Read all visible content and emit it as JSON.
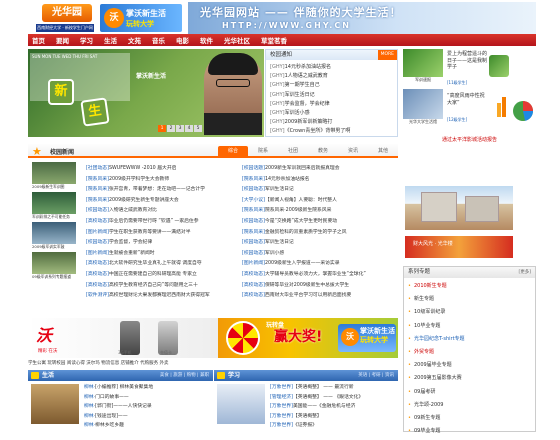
{
  "header": {
    "logo_text": "光华园",
    "logo_sub": "西南财经大学 · 新校学生门户网站",
    "logo_url": "WWW.GHY.CN",
    "wo_line1": "掌沃新生活",
    "wo_line2": "玩转大学",
    "slogan_main": "光华园网站 —— 伴随你的大学生活！",
    "slogan_url": "HTTP://WWW.GHY.CN"
  },
  "nav": [
    "首页",
    "要闻",
    "学习",
    "生活",
    "文苑",
    "音乐",
    "电影",
    "软件",
    "光华社区",
    "草堂茗香"
  ],
  "hero": {
    "days": "SUN MON TUE WED THU FRI SAT",
    "badge": "掌沃新生活",
    "pages": [
      "1",
      "2",
      "3",
      "4",
      "5"
    ],
    "active_page": 1
  },
  "notice": {
    "title": "校园通知",
    "more": "MORE",
    "items": [
      {
        "tag": "[GHY]",
        "text": "14元秒杀加油站报名"
      },
      {
        "tag": "[GHY]",
        "text": "1人物语之威武教育"
      },
      {
        "tag": "[GHY]",
        "text": "第一期学生自己"
      },
      {
        "tag": "[GHY]",
        "text": "军训生活日记"
      },
      {
        "tag": "[GHY]",
        "text": "学会监督，学会纪律"
      },
      {
        "tag": "[GHY]",
        "text": "军训活小感"
      },
      {
        "tag": "[GHY]",
        "text": "2009新军训新策略打"
      },
      {
        "tag": "[GHY]",
        "text": "《Crown青坐所》背带男了啊"
      }
    ]
  },
  "right_profiles": {
    "p1_label": "军训速报",
    "p1_text": "爱上为程营遥斗的日子——这是我制学子",
    "p1_link": "[11级学生]",
    "p3_label": "光华大学生活馆",
    "p3_text": "“高度风雨中性祝大家”",
    "p3_link": "[12级学生]",
    "headline": "通过太平洋影城活动报告"
  },
  "campus": {
    "title": "校园新闻",
    "tabs": [
      "综合",
      "院系",
      "社团",
      "教务",
      "资讯",
      "其他"
    ],
    "active_tab": 0,
    "thumbs": [
      {
        "caption": "2009级新生军训图"
      },
      {
        "caption": "军训彩排之不可能任务"
      },
      {
        "caption": "2009级军训实军鼓"
      },
      {
        "caption": "09级军训系列专题报道"
      }
    ],
    "left_news": [
      {
        "tag": "[社团动态]",
        "text": "SWUFEWWW -2010 届大开启"
      },
      {
        "tag": "[院系风采]",
        "text": "2009级开学科学生大会教师"
      },
      {
        "tag": "[院系风采]",
        "text": "张开宫青，带着梦想：走在动吧——记合计学"
      },
      {
        "tag": "[院系风采]",
        "text": "2009级研究生新生专题讲座大会"
      },
      {
        "tag": "[校园动态]",
        "text": "入物语之威武教育对比"
      },
      {
        "tag": "[高校动态]",
        "text": "毕业后仍需要带世行呀 “钦遇” 一家后住参"
      },
      {
        "tag": "[图片新闻]",
        "text": "学生在职生获教育等要讲——满结对半"
      },
      {
        "tag": "[校园动态]",
        "text": "学会监督，学会纪律"
      },
      {
        "tag": "[图片新闻]",
        "text": "生就被会重新”新闻时"
      },
      {
        "tag": "[高校动态]",
        "text": "北大软件研究生毕业真礼上午就得 调度自夺"
      },
      {
        "tag": "[高校动态]",
        "text": "中国正在需要建自己的科研理高能 专家立"
      },
      {
        "tag": "[高校动态]",
        "text": "高校学生教育经济自己向”等问题用之三十"
      },
      {
        "tag": "[软件测评]",
        "text": "高校世理财论大果发都赛理迟西南财大获得冠军"
      }
    ],
    "right_news": [
      {
        "tag": "[校园话题]",
        "text": "2009新生军训就回来后就报真理会"
      },
      {
        "tag": "[院系风采]",
        "text": "14元秒杀加油站报名"
      },
      {
        "tag": "[校园动态]",
        "text": "军训生活日记"
      },
      {
        "tag": "[大学小议]",
        "text": "【新闻人视角】人要聪：时代整人"
      },
      {
        "tag": "[院系风采]",
        "text": "院系风采·2009级新生院系风采"
      },
      {
        "tag": "[校园动态]",
        "text": "今是“交换路”成大学生更时民要动"
      },
      {
        "tag": "[院系风采]",
        "text": "金融贸检科的双重素质学生的学子之风"
      },
      {
        "tag": "[校园动态]",
        "text": "军训生活日记"
      },
      {
        "tag": "[校园动态]",
        "text": "军训小感"
      },
      {
        "tag": "[图片新闻]",
        "text": "2009级新生入学报道——采访实录"
      },
      {
        "tag": "[高校动态]",
        "text": "大学辅导员教导必须力大，掌握毕业生“全球化”"
      },
      {
        "tag": "[高校动态]",
        "text": "保研等毕业对2009级新生中总拔大学生"
      },
      {
        "tag": "[高校动态]",
        "text": "西南财大毕业平台学习可以用新后面找要"
      },
      {
        "tag": "[软件测评]",
        "text": "超值享“时时”，三成大学毕业生想创业"
      }
    ]
  },
  "sidebar_title": "系列专题",
  "sidebar_date": "2009-09-25",
  "hall_caption": "财大风光 · 光华楼",
  "special": {
    "title": "系列专题",
    "more": "[更多]",
    "items": [
      {
        "text": "2010新生专题",
        "style": "red"
      },
      {
        "text": "新生专题",
        "style": "normal"
      },
      {
        "text": "10级军训纪录",
        "style": "normal"
      },
      {
        "text": "10毕业专题",
        "style": "normal"
      },
      {
        "text": "光华园纪念T-shirt专题",
        "style": "blue"
      },
      {
        "text": "外贸专题",
        "style": "red"
      },
      {
        "text": "2009届毕业专题",
        "style": "normal"
      },
      {
        "text": "2009第五届影像大赛",
        "style": "normal"
      },
      {
        "text": "09届考研",
        "style": "normal"
      },
      {
        "text": "光华颂-2009",
        "style": "normal"
      },
      {
        "text": "09新生专题",
        "style": "normal"
      },
      {
        "text": "09毕业专题",
        "style": "normal"
      }
    ]
  },
  "banner": {
    "wo": "沃",
    "wo_sub": "精彩 在沃",
    "phones": [
      "3G手机",
      "充值卡"
    ],
    "small": "玩转盘",
    "big": "赢大奖!",
    "wo2_l1": "掌沃新生活",
    "wo2_l2": "玩转大学"
  },
  "linkbar": "  学生公寓  玩转校园  阅读心得  沃尔玛  物流信息  店铺推介  代购服务  外卖",
  "life": {
    "title": "生活",
    "right": "美食 | 旅游 | 购物 | 兼职",
    "items": [
      {
        "tag": "柳林·",
        "text": "[小编推荐] 柳林美食聚集地"
      },
      {
        "tag": "柳林·",
        "text": "门口的故事——"
      },
      {
        "tag": "柳林·",
        "text": "[郭门街]——一人快快记录"
      },
      {
        "tag": "柳林·",
        "text": "[钱途出现]——"
      },
      {
        "tag": "柳林·",
        "text": "柳林乡吃乡趣"
      },
      {
        "tag": "柳林·",
        "text": "温家城镇大开肘"
      }
    ]
  },
  "study": {
    "title": "学习",
    "right": "英语 | 考研 | 资讯",
    "items": [
      {
        "tag": "[万象世界]",
        "text": "【英语概整】 —— 最流行新"
      },
      {
        "tag": "[管理经济]",
        "text": "【英语概整】 —— 《跟话文化》"
      },
      {
        "tag": "[万象世界]",
        "text": "美国能——《金融危机与经济"
      },
      {
        "tag": "[万象世界]",
        "text": "【英语概整】"
      },
      {
        "tag": "[万象世界]",
        "text": "《证券报》"
      },
      {
        "tag": "[万象世界]",
        "text": "Q新语文"
      }
    ]
  }
}
